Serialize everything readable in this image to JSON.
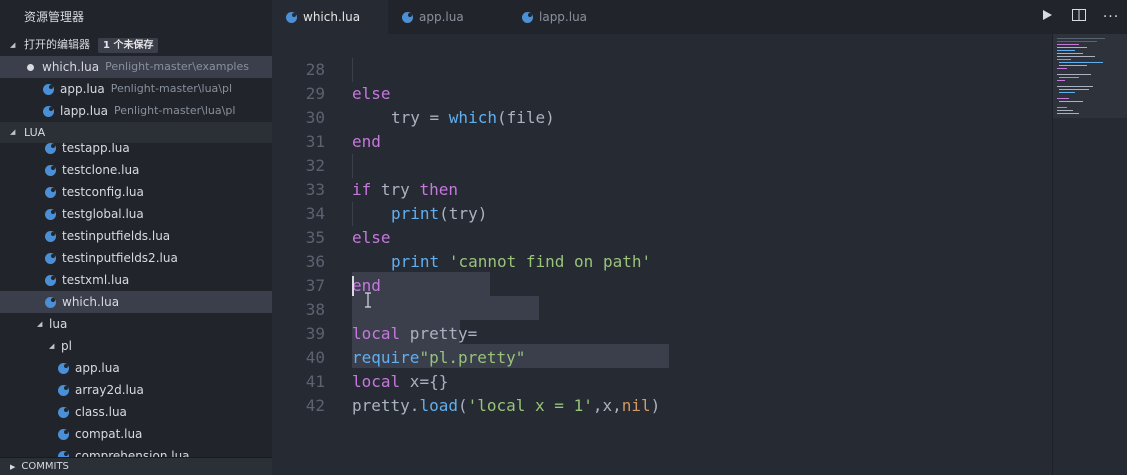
{
  "sidebar": {
    "title": "资源管理器",
    "open_editors": {
      "label": "打开的编辑器",
      "badge": "1 个未保存",
      "items": [
        {
          "name": "which.lua",
          "path": "Penlight-master\\examples",
          "modified": true
        },
        {
          "name": "app.lua",
          "path": "Penlight-master\\lua\\pl",
          "modified": false
        },
        {
          "name": "lapp.lua",
          "path": "Penlight-master\\lua\\pl",
          "modified": false
        }
      ]
    },
    "lua_section": {
      "label": "LUA",
      "files_top": [
        "testapp.lua",
        "testclone.lua",
        "testconfig.lua",
        "testglobal.lua",
        "testinputfields.lua",
        "testinputfields2.lua",
        "testxml.lua",
        "which.lua"
      ],
      "folder_lua": "lua",
      "folder_pl": "pl",
      "files_pl": [
        "app.lua",
        "array2d.lua",
        "class.lua",
        "compat.lua",
        "comprehension.lua"
      ]
    },
    "commits_label": "COMMITS"
  },
  "tabs": [
    {
      "label": "which.lua",
      "active": true,
      "modified": true
    },
    {
      "label": "app.lua",
      "active": false,
      "modified": false
    },
    {
      "label": "lapp.lua",
      "active": false,
      "modified": false
    }
  ],
  "editor": {
    "line_numbers": [
      "28",
      "29",
      "30",
      "31",
      "32",
      "33",
      "34",
      "35",
      "36",
      "37",
      "38",
      "39",
      "40",
      "41",
      "42"
    ],
    "lines": {
      "l28": {
        "kw": "else"
      },
      "l29": {
        "a": "try = ",
        "fn": "which",
        "b": "(file)"
      },
      "l30": {
        "kw": "end"
      },
      "l32": {
        "kw1": "if",
        "mid": " try ",
        "kw2": "then"
      },
      "l33": {
        "fn": "print",
        "b": "(try)"
      },
      "l34": {
        "kw": "else"
      },
      "l35": {
        "fn": "print",
        "sp": " ",
        "str": "'cannot find on path'"
      },
      "l36": {
        "kw": "end"
      },
      "l38": {
        "kw": "local",
        "b": " pretty="
      },
      "l39": {
        "fn": "require",
        "str": "\"pl.pretty\""
      },
      "l40": {
        "kw": "local",
        "b": " x={}"
      },
      "l41": {
        "a": "pretty.",
        "fn": "load",
        "b": "(",
        "str": "'local x = 1'",
        "c": ",x,",
        "num": "nil",
        "d": ")"
      }
    }
  },
  "colors": {
    "keyword": "#c678dd",
    "function": "#61afef",
    "string": "#98c379",
    "constant": "#d19a66",
    "lua_icon": "#4b8fd6"
  }
}
